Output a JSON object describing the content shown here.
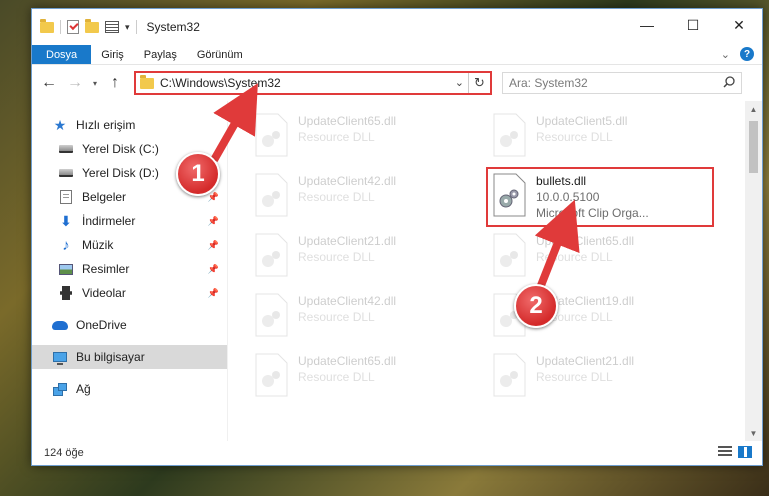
{
  "window": {
    "title": "System32",
    "controls": {
      "minimize": "—",
      "maximize": "☐",
      "close": "✕"
    }
  },
  "ribbon": {
    "tabs": [
      "Dosya",
      "Giriş",
      "Paylaş",
      "Görünüm"
    ],
    "help": "?"
  },
  "address": {
    "path": "C:\\Windows\\System32",
    "search_placeholder": "Ara: System32"
  },
  "nav": {
    "quick_access": "Hızlı erişim",
    "items": [
      {
        "label": "Yerel Disk (C:)",
        "icon": "disk-icon",
        "pinned": false
      },
      {
        "label": "Yerel Disk (D:)",
        "icon": "disk-icon",
        "pinned": true
      },
      {
        "label": "Belgeler",
        "icon": "documents-icon",
        "pinned": true
      },
      {
        "label": "İndirmeler",
        "icon": "download-icon",
        "pinned": true
      },
      {
        "label": "Müzik",
        "icon": "music-icon",
        "pinned": true
      },
      {
        "label": "Resimler",
        "icon": "pictures-icon",
        "pinned": true
      },
      {
        "label": "Videolar",
        "icon": "videos-icon",
        "pinned": true
      }
    ],
    "onedrive": "OneDrive",
    "this_pc": "Bu bilgisayar",
    "network": "Ağ"
  },
  "files": {
    "left": [
      {
        "name": "UpdateClient65.dll",
        "desc": "Resource DLL"
      },
      {
        "name": "UpdateClient42.dll",
        "desc": "Resource DLL"
      },
      {
        "name": "UpdateClient21.dll",
        "desc": "Resource DLL"
      },
      {
        "name": "UpdateClient42.dll",
        "desc": "Resource DLL"
      },
      {
        "name": "UpdateClient65.dll",
        "desc": "Resource DLL"
      }
    ],
    "right": [
      {
        "name": "UpdateClient5.dll",
        "desc": "Resource DLL"
      },
      {
        "name": "UpdateClient65.dll",
        "desc": "Resource DLL"
      },
      {
        "name": "UpdateClient19.dll",
        "desc": "Resource DLL"
      },
      {
        "name": "UpdateClient21.dll",
        "desc": "Resource DLL"
      }
    ],
    "highlighted": {
      "name": "bullets.dll",
      "version": "10.0.0.5100",
      "desc": "Microsoft Clip Orga..."
    }
  },
  "status": {
    "count": "124 öğe"
  },
  "annotations": {
    "badge1": "1",
    "badge2": "2",
    "accent": "#e03a3a"
  }
}
